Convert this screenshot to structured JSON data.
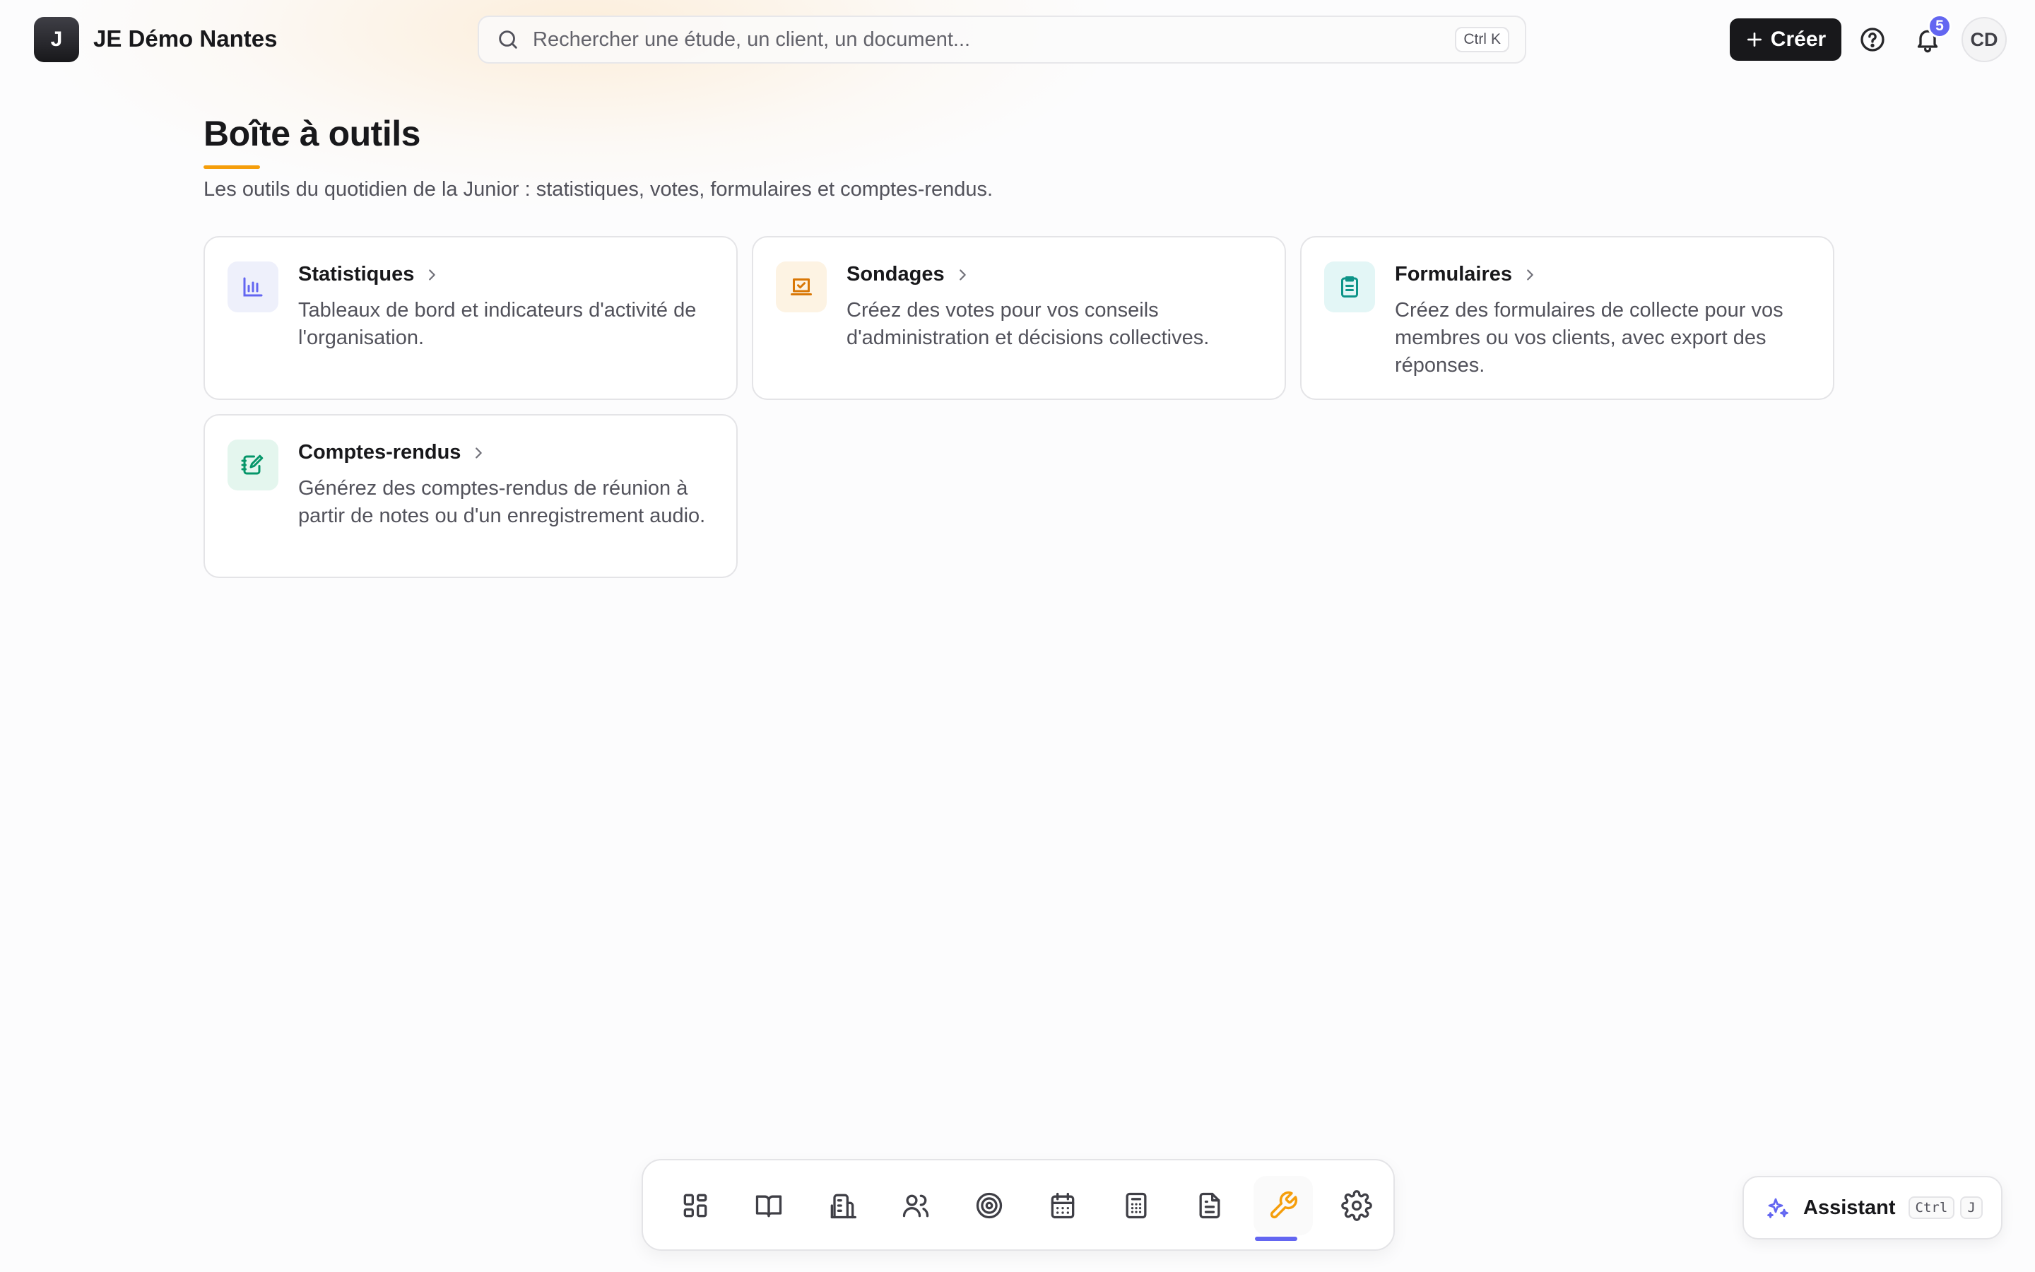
{
  "header": {
    "logo_letter": "J",
    "org_name": "JE Démo Nantes",
    "search_placeholder": "Rechercher une étude, un client, un document...",
    "search_shortcut": [
      "Ctrl",
      "K"
    ],
    "create_label": "Créer",
    "notification_count": "5",
    "avatar_initials": "CD"
  },
  "page": {
    "title": "Boîte à outils",
    "subtitle": "Les outils du quotidien de la Junior : statistiques, votes, formulaires et comptes-rendus."
  },
  "cards": [
    {
      "title": "Statistiques",
      "description": "Tableaux de bord et indicateurs d'activité de l'organisation.",
      "icon": "bar-chart-icon",
      "accent": "#6366f1"
    },
    {
      "title": "Sondages",
      "description": "Créez des votes pour vos conseils d'administration et décisions collectives.",
      "icon": "vote-icon",
      "accent": "#d97706"
    },
    {
      "title": "Formulaires",
      "description": "Créez des formulaires de collecte pour vos membres ou vos clients, avec export des réponses.",
      "icon": "clipboard-list-icon",
      "accent": "#0d9488"
    },
    {
      "title": "Comptes-rendus",
      "description": "Générez des comptes-rendus de réunion à partir de notes ou d'un enregistrement audio.",
      "icon": "notebook-pen-icon",
      "accent": "#059669"
    }
  ],
  "dock": {
    "items": [
      "dashboard-icon",
      "book-icon",
      "building-icon",
      "users-icon",
      "target-icon",
      "calendar-icon",
      "calculator-icon",
      "document-icon",
      "wrench-icon",
      "settings-icon"
    ],
    "active": "wrench-icon",
    "indicator_color": "#6366f1"
  },
  "assistant": {
    "label": "Assistant",
    "shortcut": [
      "Ctrl",
      "J"
    ]
  },
  "colors": {
    "accent_orange": "#f59e0b",
    "accent_indigo": "#6366f1",
    "primary_button": "#18181b"
  }
}
